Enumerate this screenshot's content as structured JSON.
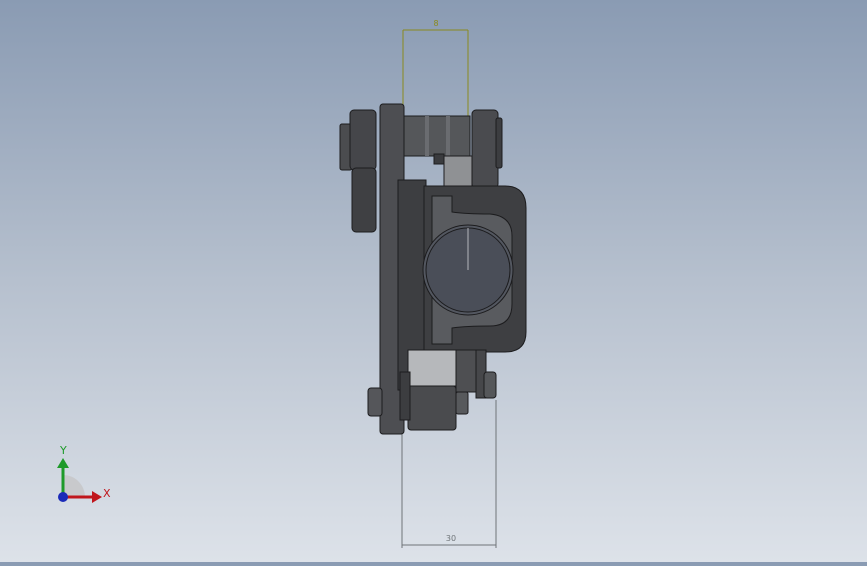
{
  "viewport": {
    "background_top": "#8a9bb3",
    "background_bottom": "#dde2e9"
  },
  "dimensions": {
    "top": {
      "value": "8",
      "color": "#8a8a1e"
    },
    "bottom": {
      "value": "30",
      "color": "#6f7478"
    }
  },
  "model": {
    "part_color_dark": "#3a3b3d",
    "part_color_mid": "#5a5c5f",
    "part_color_light": "#9a9c9f",
    "shaft_color": "#4a4e58"
  },
  "triad": {
    "x_label": "X",
    "y_label": "Y",
    "x_color": "#c0161c",
    "y_color": "#1e9a2a",
    "z_color": "#1a2ab8"
  }
}
